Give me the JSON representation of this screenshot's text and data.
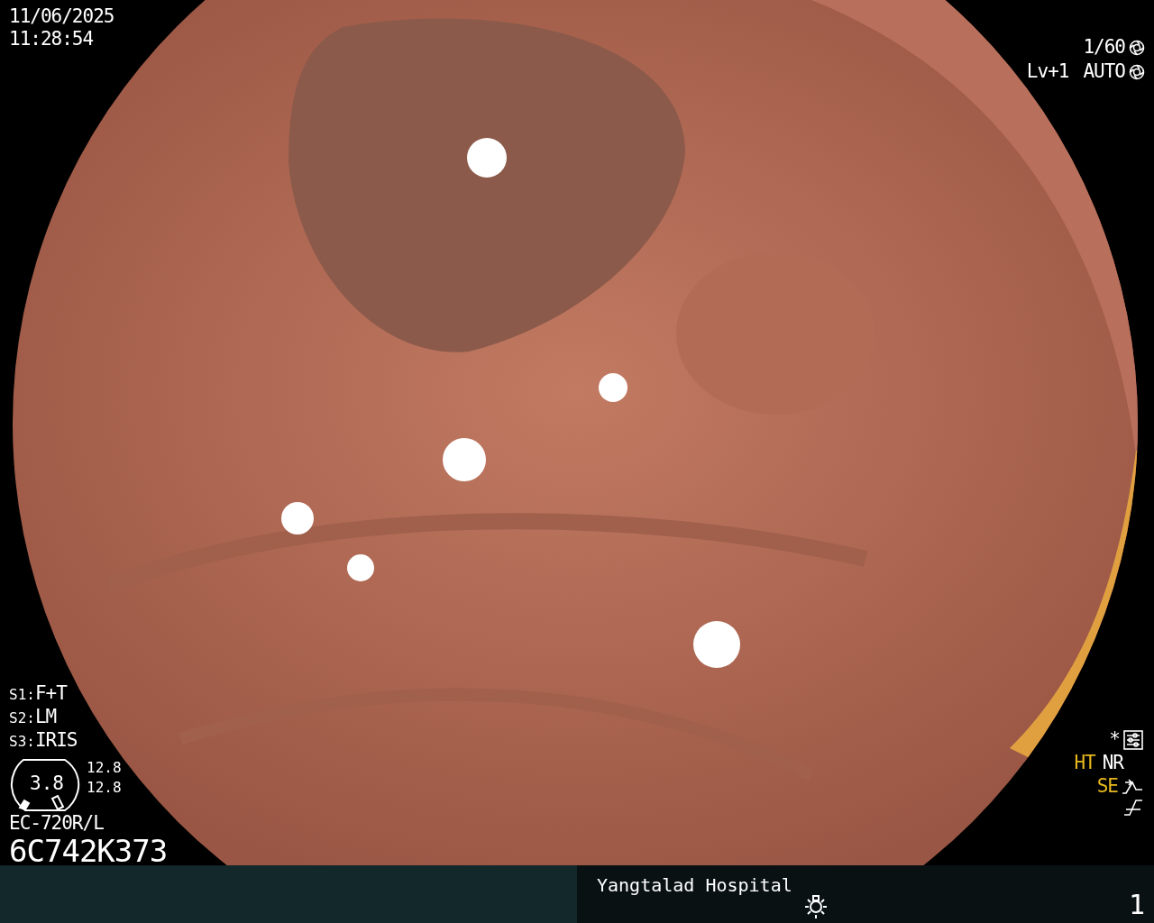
{
  "datetime": {
    "date": "11/06/2025",
    "time": "11:28:54"
  },
  "exposure": {
    "shutter": "1/60",
    "level": "Lv+1",
    "iris": "AUTO"
  },
  "switches": [
    {
      "label": "S1:",
      "value": "F+T"
    },
    {
      "label": "S2:",
      "value": "LM"
    },
    {
      "label": "S3:",
      "value": "IRIS"
    }
  ],
  "scope": {
    "value": "3.8",
    "readings": [
      "12.8",
      "12.8"
    ],
    "model": "EC-720R/L",
    "serial": "6C742K373"
  },
  "indicators": {
    "star": "*",
    "modes": [
      {
        "label": "HT",
        "color": "#e8b81e"
      },
      {
        "label": "NR",
        "color": "#ffffff"
      }
    ],
    "enhance": {
      "label": "SE",
      "color": "#e8b81e"
    }
  },
  "footer": {
    "hospital": "Yangtalad Hospital",
    "number": "1"
  }
}
